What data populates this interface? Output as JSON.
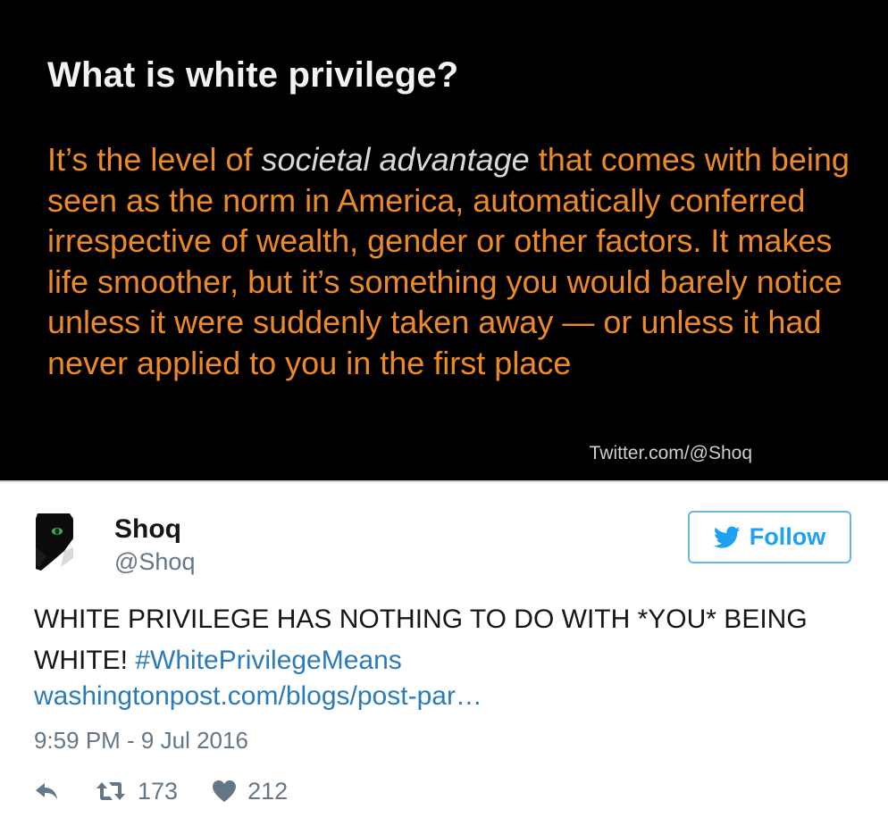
{
  "media": {
    "title": "What is white privilege?",
    "body_before": "It’s the level of ",
    "body_highlight": "societal advantage",
    "body_after": " that comes with being seen as the norm in America, automatically conferred irrespective of wealth, gender or other factors. It makes life smoother, but it’s something you would barely notice unless it were suddenly taken away — or unless it had never applied to you in the first place",
    "credit": "Twitter.com/@Shoq"
  },
  "author": {
    "name": "Shoq",
    "handle": "@Shoq",
    "avatar_icon": "black-cat-avatar"
  },
  "follow": {
    "label": "Follow",
    "icon": "twitter-bird-icon",
    "color": "#1da1f2"
  },
  "tweet": {
    "text": "WHITE PRIVILEGE HAS NOTHING TO DO WITH *YOU* BEING WHITE! ",
    "hashtag": "#WhitePrivilegeMeans",
    "link": "washingtonpost.com/blogs/post-par…",
    "timestamp": "9:59 PM - 9 Jul 2016"
  },
  "actions": {
    "reply_icon": "reply-icon",
    "retweet_icon": "retweet-icon",
    "retweet_count": "173",
    "like_icon": "heart-icon",
    "like_count": "212"
  },
  "colors": {
    "media_background": "#000000",
    "media_body_text": "#ee8a26",
    "link": "#2b7bb9",
    "muted": "#657786"
  }
}
